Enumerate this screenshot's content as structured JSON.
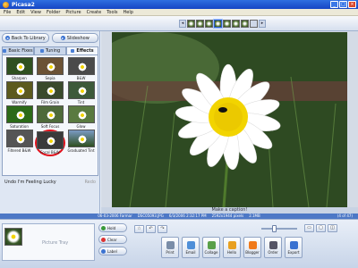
{
  "window": {
    "title": "Picasa2",
    "min": "_",
    "max": "□",
    "close": "×"
  },
  "menu": [
    "File",
    "Edit",
    "View",
    "Folder",
    "Picture",
    "Create",
    "Tools",
    "Help"
  ],
  "filmstrip": {
    "prev": "◂",
    "next": "▸"
  },
  "nav": {
    "back_label": "Back To Library",
    "slideshow_label": "Slideshow"
  },
  "tabs": [
    "Basic Fixes",
    "Tuning",
    "Effects"
  ],
  "effects": [
    "Sharpen",
    "Sepia",
    "B&W",
    "Warmify",
    "Film Grain",
    "Tint",
    "Saturation",
    "Soft Focus",
    "Glow",
    "Filtered B&W",
    "Focal B&W",
    "Graduated Tint"
  ],
  "lucky": {
    "label": "Undo I'm Feeling Lucky",
    "redo": "Redo"
  },
  "caption_placeholder": "Make a caption!",
  "status": {
    "date": "06-03-2006 Farmar",
    "file": "DSC05093.JPG",
    "taken": "6/3/2006 2:32:17 PM",
    "dims": "2592x1944 pixels",
    "size": "2.1MB",
    "pager": "(4 of 47)"
  },
  "tray": {
    "label": "Picture Tray",
    "hold": "Hold",
    "clear": "Clear",
    "label_btn": "Label"
  },
  "actions": [
    "Print",
    "Email",
    "Collage",
    "Hello",
    "Blogger",
    "Order",
    "Export"
  ],
  "colors": {
    "accent": "#2f6fe0",
    "highlight_ring": "#e0101a",
    "petal": "#ffffff",
    "center": "#f2d400"
  }
}
